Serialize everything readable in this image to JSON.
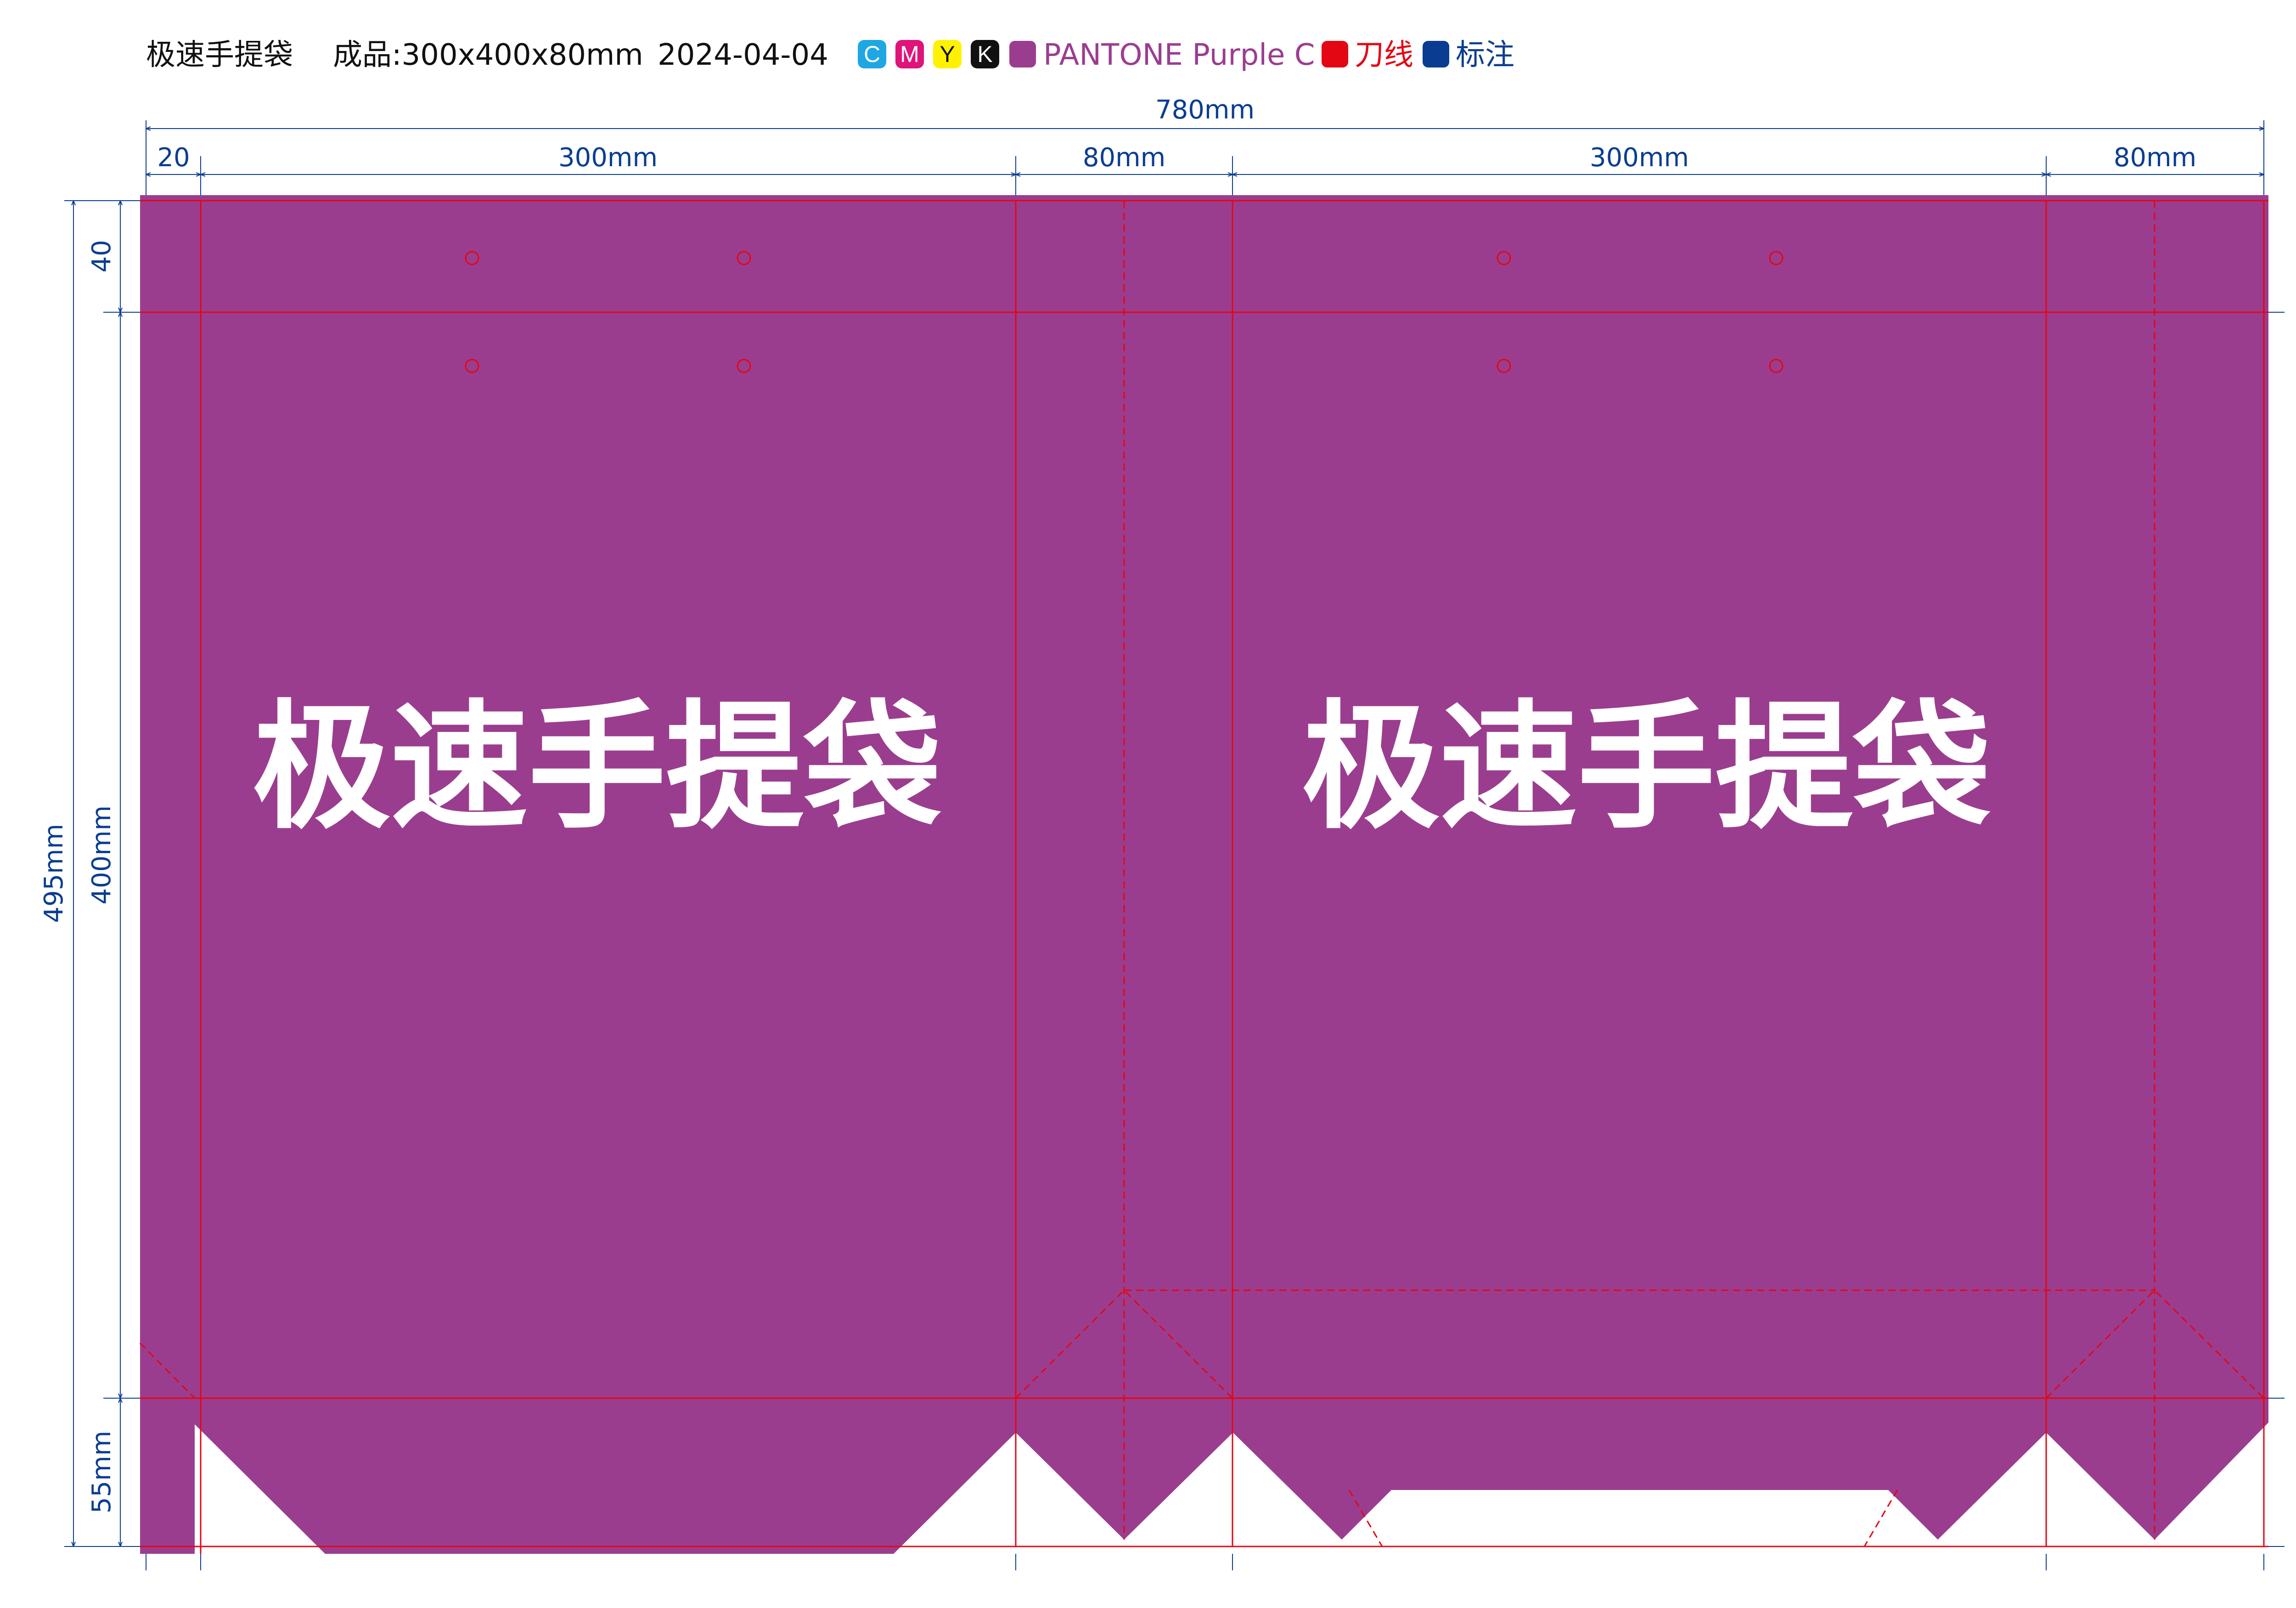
{
  "header": {
    "product_name": "极速手提袋",
    "size_label": "成品:300x400x80mm",
    "date": "2024-04-04"
  },
  "legend": {
    "process_colors": [
      {
        "letter": "C",
        "color": "#1ea7e1"
      },
      {
        "letter": "M",
        "color": "#e0137a"
      },
      {
        "letter": "Y",
        "color": "#fff200"
      },
      {
        "letter": "K",
        "color": "#111111"
      }
    ],
    "spot": {
      "label": "PANTONE Purple C",
      "color": "#9b3d8f"
    },
    "cut_line": {
      "label": "刀线",
      "color": "#e30613"
    },
    "annotation": {
      "label": "标注",
      "color": "#0a3d91"
    }
  },
  "dimensions": {
    "total_width": "780mm",
    "glue_flap": "20",
    "front_width": "300mm",
    "gusset_1": "80mm",
    "back_width": "300mm",
    "gusset_2": "80mm",
    "total_height": "495mm",
    "top_fold": "40",
    "body_height": "400mm",
    "bottom": "55mm"
  },
  "panels": {
    "front_title": "极速手提袋",
    "back_title": "极速手提袋"
  },
  "colors": {
    "bag_purple": "#9b3d8f",
    "cut_line": "#e30613",
    "dimension_blue": "#0a3d91",
    "panel_text": "#ffffff"
  }
}
